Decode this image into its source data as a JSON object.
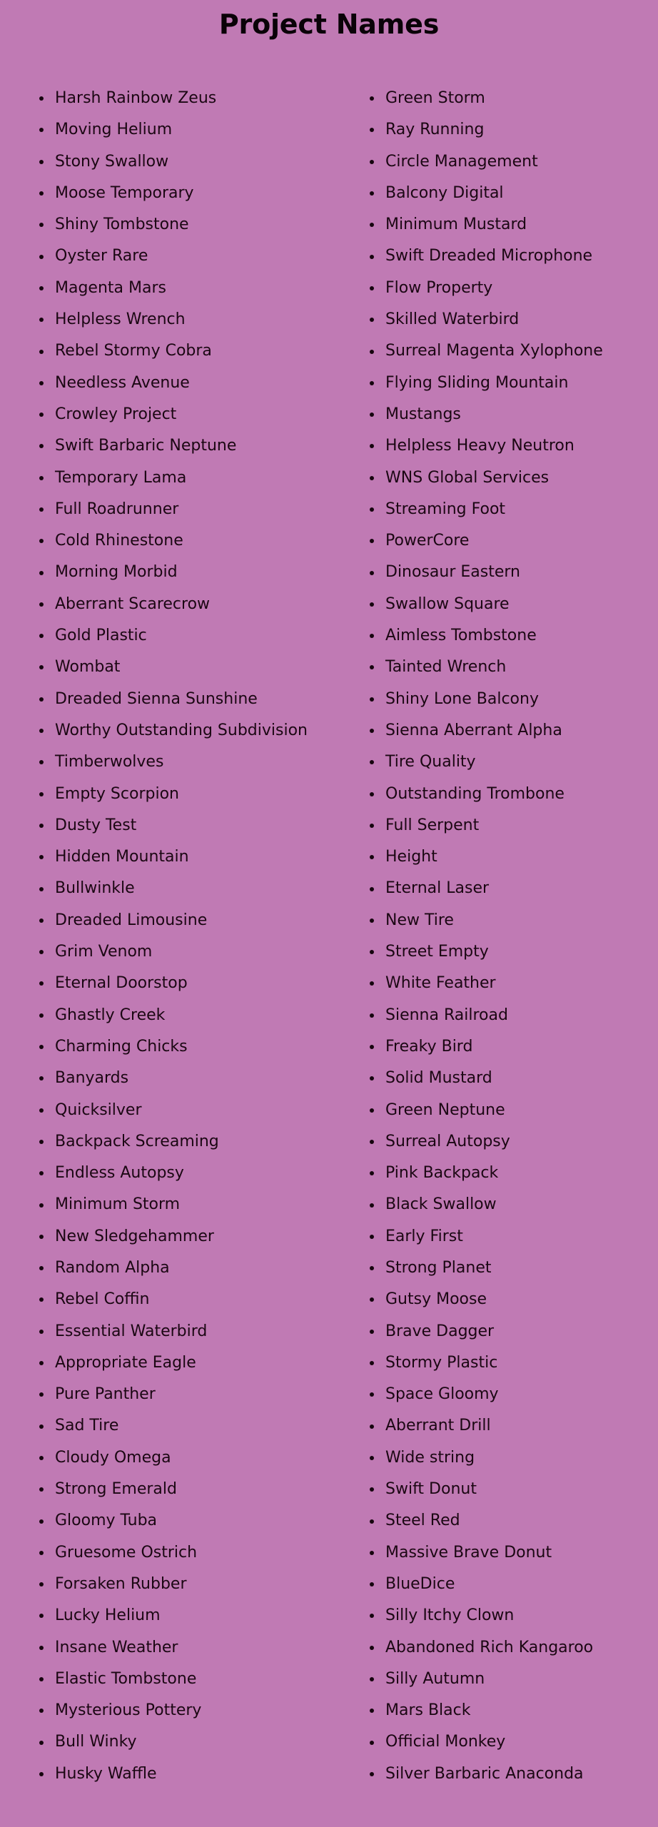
{
  "page": {
    "title": "Project Names",
    "background_color": "#c07ab4",
    "text_color": "#1b0713",
    "title_color": "#0a0208"
  },
  "columns": {
    "left": [
      "Harsh Rainbow Zeus",
      "Moving Helium",
      "Stony Swallow",
      "Moose Temporary",
      "Shiny Tombstone",
      "Oyster Rare",
      "Magenta Mars",
      "Helpless Wrench",
      "Rebel Stormy Cobra",
      "Needless Avenue",
      "Crowley Project",
      "Swift Barbaric Neptune",
      "Temporary Lama",
      "Full Roadrunner",
      "Cold Rhinestone",
      "Morning Morbid",
      "Aberrant Scarecrow",
      "Gold Plastic",
      "Wombat",
      "Dreaded Sienna Sunshine",
      "Worthy Outstanding Subdivision",
      "Timberwolves",
      "Empty Scorpion",
      "Dusty Test",
      "Hidden Mountain",
      "Bullwinkle",
      "Dreaded Limousine",
      "Grim Venom",
      "Eternal Doorstop",
      "Ghastly Creek",
      "Charming Chicks",
      "Banyards",
      "Quicksilver",
      "Backpack Screaming",
      "Endless Autopsy",
      "Minimum Storm",
      "New Sledgehammer",
      "Random Alpha",
      "Rebel Coffin",
      "Essential Waterbird",
      "Appropriate Eagle",
      "Pure Panther",
      "Sad Tire",
      "Cloudy Omega",
      "Strong Emerald",
      "Gloomy Tuba",
      "Gruesome Ostrich",
      "Forsaken Rubber",
      "Lucky Helium",
      "Insane Weather",
      "Elastic Tombstone",
      "Mysterious Pottery",
      "Bull Winky",
      "Husky Waffle"
    ],
    "right": [
      "Green Storm",
      "Ray Running",
      "Circle Management",
      "Balcony Digital",
      "Minimum Mustard",
      "Swift Dreaded Microphone",
      "Flow Property",
      "Skilled Waterbird",
      "Surreal Magenta Xylophone",
      "Flying Sliding Mountain",
      "Mustangs",
      "Helpless Heavy Neutron",
      "WNS Global Services",
      "Streaming Foot",
      "PowerCore",
      "Dinosaur Eastern",
      "Swallow Square",
      "Aimless Tombstone",
      "Tainted Wrench",
      "Shiny Lone Balcony",
      "Sienna Aberrant Alpha",
      "Tire Quality",
      "Outstanding Trombone",
      "Full Serpent",
      "Height",
      "Eternal Laser",
      "New Tire",
      "Street Empty",
      "White Feather",
      "Sienna Railroad",
      "Freaky Bird",
      "Solid Mustard",
      "Green Neptune",
      "Surreal Autopsy",
      "Pink Backpack",
      "Black Swallow",
      "Early First",
      "Strong Planet",
      "Gutsy Moose",
      "Brave Dagger",
      "Stormy Plastic",
      "Space Gloomy",
      "Aberrant Drill",
      "Wide string",
      "Swift Donut",
      "Steel Red",
      "Massive Brave Donut",
      "BlueDice",
      "Silly Itchy Clown",
      "Abandoned Rich Kangaroo",
      "Silly Autumn",
      "Mars Black",
      "Official Monkey",
      "Silver Barbaric Anaconda"
    ]
  }
}
